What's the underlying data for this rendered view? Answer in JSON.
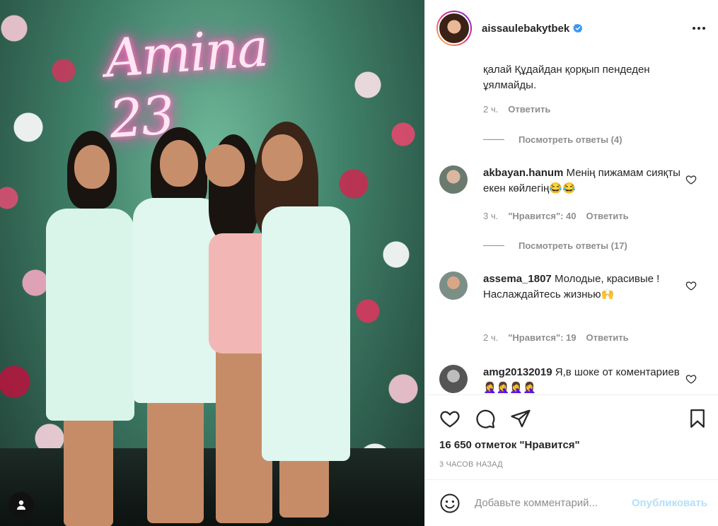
{
  "post": {
    "photo_neon_text": "Amina 23",
    "photo_alt_icon": "user-tag-icon"
  },
  "header": {
    "username": "aissaulebakytbek",
    "verified_icon": "verified-badge-icon",
    "more_icon": "more-options-icon"
  },
  "comments": {
    "continued": {
      "text": "қалай Құдайдан қорқып пендеден ұялмайды.",
      "time": "2 ч.",
      "reply": "Ответить"
    },
    "view_replies_1": "Посмотреть ответы (4)",
    "items": [
      {
        "username": "akbayan.hanum",
        "text": "Менің пижамам сияқты екен көйлегің😂😂",
        "time": "3 ч.",
        "likes": "\"Нравится\": 40",
        "reply": "Ответить"
      },
      {
        "username": "assema_1807",
        "text": "Молодые, красивые ! Наслаждайтесь жизнью🙌",
        "time": "2 ч.",
        "likes": "\"Нравится\": 19",
        "reply": "Ответить"
      },
      {
        "username": "amg20132019",
        "text": "Я,в шоке от коментариев 🤦‍♀️🤦‍♀️🤦‍♀️🤦‍♀️"
      }
    ],
    "view_replies_2": "Посмотреть ответы (17)"
  },
  "actions": {
    "like_icon": "heart-icon",
    "comment_icon": "comment-icon",
    "share_icon": "share-icon",
    "save_icon": "bookmark-icon",
    "likes_count": "16 650 отметок \"Нравится\"",
    "posted_time": "3 ЧАСОВ НАЗАД"
  },
  "add_comment": {
    "placeholder": "Добавьте комментарий...",
    "publish": "Опубликовать"
  },
  "colors": {
    "accent": "#0095f6",
    "publish_disabled": "#b2dffc",
    "muted": "#8e8e8e",
    "text": "#262626"
  }
}
